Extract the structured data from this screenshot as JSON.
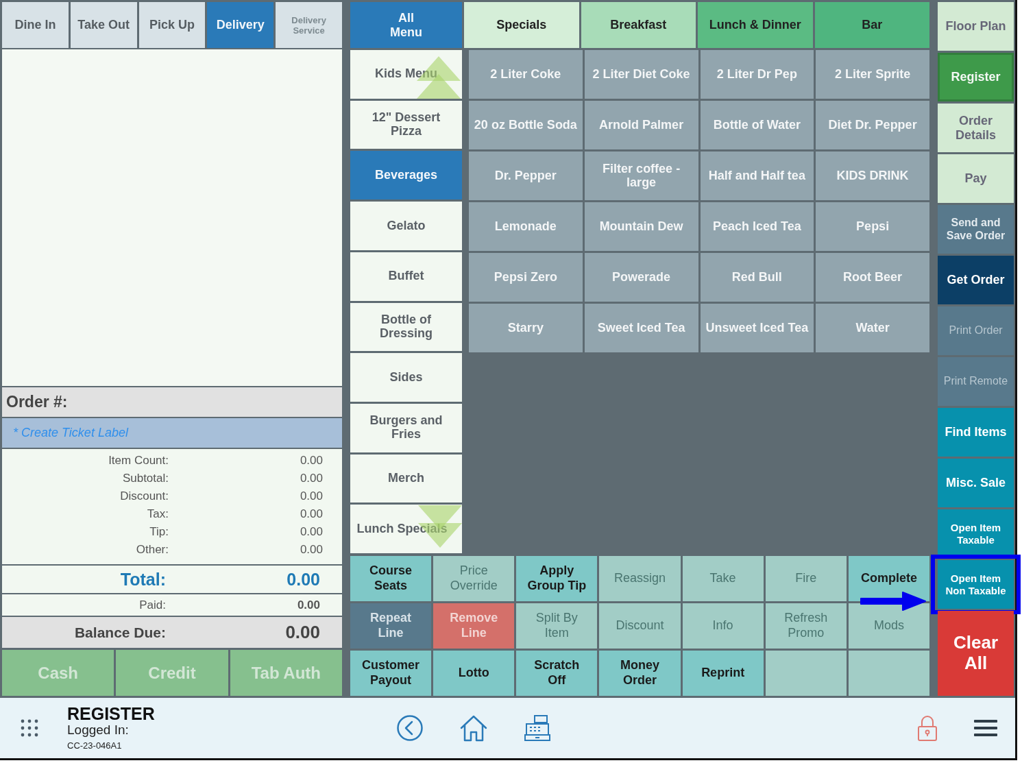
{
  "order_tabs": [
    {
      "label": "Dine In",
      "selected": false,
      "disabled": false
    },
    {
      "label": "Take Out",
      "selected": false,
      "disabled": false
    },
    {
      "label": "Pick Up",
      "selected": false,
      "disabled": false
    },
    {
      "label": "Delivery",
      "selected": true,
      "disabled": false
    },
    {
      "label": "Delivery Service",
      "selected": false,
      "disabled": true
    }
  ],
  "order_panel": {
    "order_number_label": "Order #:",
    "ticket_label_link": "* Create Ticket Label",
    "summary": [
      {
        "label": "Item Count:",
        "value": "0.00"
      },
      {
        "label": "Subtotal:",
        "value": "0.00"
      },
      {
        "label": "Discount:",
        "value": "0.00"
      },
      {
        "label": "Tax:",
        "value": "0.00"
      },
      {
        "label": "Tip:",
        "value": "0.00"
      },
      {
        "label": "Other:",
        "value": "0.00"
      }
    ],
    "total": {
      "label": "Total:",
      "value": "0.00"
    },
    "paid": {
      "label": "Paid:",
      "value": "0.00"
    },
    "balance_due": {
      "label": "Balance Due:",
      "value": "0.00"
    },
    "payment_buttons": [
      {
        "label": "Cash",
        "disabled": true
      },
      {
        "label": "Credit",
        "disabled": true
      },
      {
        "label": "Tab Auth",
        "disabled": true
      }
    ]
  },
  "menu_tabs": [
    {
      "label": "All Menu",
      "kind": "all",
      "selected": true,
      "color": "#2a7ab8"
    },
    {
      "label": "Specials",
      "kind": "group",
      "selected": false,
      "color": "#d5eed8"
    },
    {
      "label": "Breakfast",
      "kind": "group",
      "selected": false,
      "color": "#a8dcb8"
    },
    {
      "label": "Lunch & Dinner",
      "kind": "group",
      "selected": false,
      "color": "#5bbb83"
    },
    {
      "label": "Bar",
      "kind": "group",
      "selected": false,
      "color": "#4fb57f"
    }
  ],
  "categories": [
    {
      "label": "Kids Menu",
      "selected": false
    },
    {
      "label": "12\" Dessert Pizza",
      "selected": false
    },
    {
      "label": "Beverages",
      "selected": true
    },
    {
      "label": "Gelato",
      "selected": false
    },
    {
      "label": "Buffet",
      "selected": false
    },
    {
      "label": "Bottle of Dressing",
      "selected": false
    },
    {
      "label": "Sides",
      "selected": false
    },
    {
      "label": "Burgers and Fries",
      "selected": false
    },
    {
      "label": "Merch",
      "selected": false
    },
    {
      "label": "Lunch Specials",
      "selected": false
    }
  ],
  "items": [
    "2 Liter Coke",
    "2 Liter Diet Coke",
    "2 Liter Dr Pep",
    "2 Liter Sprite",
    "20 oz Bottle Soda",
    "Arnold Palmer",
    "Bottle of Water",
    "Diet Dr. Pepper",
    "Dr. Pepper",
    "Filter coffee - large",
    "Half and Half tea",
    "KIDS DRINK",
    "Lemonade",
    "Mountain Dew",
    "Peach Iced Tea",
    "Pepsi",
    "Pepsi Zero",
    "Powerade",
    "Red Bull",
    "Root Beer",
    "Starry",
    "Sweet Iced Tea",
    "Unsweet Iced Tea",
    "Water"
  ],
  "action_buttons": [
    {
      "label": "Course Seats",
      "kind": "active"
    },
    {
      "label": "Price Override",
      "kind": "disabled"
    },
    {
      "label": "Apply Group Tip",
      "kind": "active"
    },
    {
      "label": "Reassign",
      "kind": "disabled"
    },
    {
      "label": "Take",
      "kind": "disabled"
    },
    {
      "label": "Fire",
      "kind": "disabled"
    },
    {
      "label": "Complete",
      "kind": "active"
    },
    {
      "label": "Repeat Line",
      "kind": "slate"
    },
    {
      "label": "Remove Line",
      "kind": "danger"
    },
    {
      "label": "Split By Item",
      "kind": "disabled"
    },
    {
      "label": "Discount",
      "kind": "disabled"
    },
    {
      "label": "Info",
      "kind": "disabled"
    },
    {
      "label": "Refresh Promo",
      "kind": "disabled"
    },
    {
      "label": "Mods",
      "kind": "disabled"
    },
    {
      "label": "Customer Payout",
      "kind": "active"
    },
    {
      "label": "Lotto",
      "kind": "active"
    },
    {
      "label": "Scratch Off",
      "kind": "active"
    },
    {
      "label": "Money Order",
      "kind": "active"
    },
    {
      "label": "Reprint",
      "kind": "active"
    },
    {
      "kind": "disabled"
    },
    {
      "kind": "disabled"
    }
  ],
  "side_buttons": [
    {
      "label": "Floor Plan",
      "kind": "nav",
      "selected": false,
      "disabled": false,
      "highlighted": false
    },
    {
      "label": "Register",
      "kind": "nav",
      "selected": true,
      "disabled": false,
      "highlighted": false
    },
    {
      "label": "Order Details",
      "kind": "nav",
      "selected": false,
      "disabled": false,
      "highlighted": false
    },
    {
      "label": "Pay",
      "kind": "nav",
      "selected": false,
      "disabled": false,
      "highlighted": false
    },
    {
      "label": "Send and Save Order",
      "kind": "slate",
      "selected": false,
      "disabled": false,
      "highlighted": false
    },
    {
      "label": "Get Order",
      "kind": "navy",
      "selected": false,
      "disabled": false,
      "highlighted": false
    },
    {
      "label": "Print Order",
      "kind": "slate",
      "selected": false,
      "disabled": true,
      "highlighted": false
    },
    {
      "label": "Print Remote",
      "kind": "slate",
      "selected": false,
      "disabled": true,
      "highlighted": false
    },
    {
      "label": "Find Items",
      "kind": "teal",
      "selected": false,
      "disabled": false,
      "highlighted": false
    },
    {
      "label": "Misc. Sale",
      "kind": "teal",
      "selected": false,
      "disabled": false,
      "highlighted": false
    },
    {
      "label": "Open Item Taxable",
      "kind": "teal",
      "selected": false,
      "disabled": false,
      "highlighted": false
    },
    {
      "label": "Open Item Non Taxable",
      "kind": "teal",
      "selected": false,
      "disabled": false,
      "highlighted": true
    },
    {
      "label": "Clear All",
      "kind": "danger",
      "selected": false,
      "disabled": false,
      "highlighted": false
    }
  ],
  "bottom_bar": {
    "title": "REGISTER",
    "logged_in_label": "Logged In:",
    "terminal_id": "CC-23-046A1"
  }
}
